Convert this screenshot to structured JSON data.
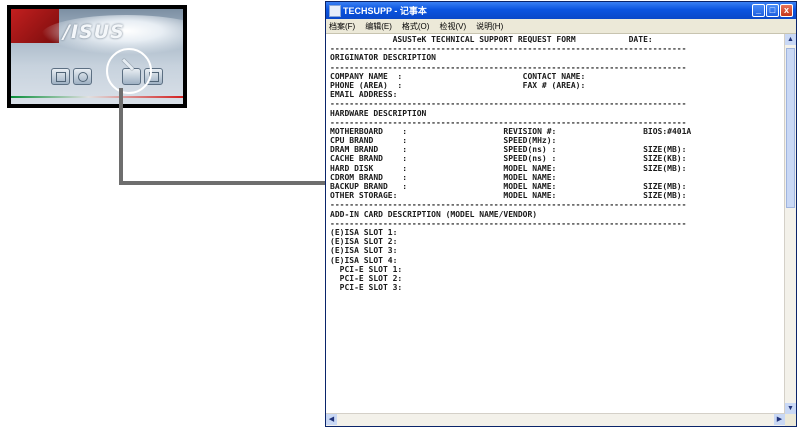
{
  "launcher": {
    "logo_text": "/ISUS",
    "buttons": [
      "info-icon",
      "globe-icon",
      "wrench-icon",
      "mail-icon"
    ],
    "highlighted": "wrench-icon"
  },
  "window": {
    "title": "TECHSUPP - 记事本",
    "menu": [
      "档案(F)",
      "编辑(E)",
      "格式(O)",
      "检视(V)",
      "说明(H)"
    ],
    "controls": {
      "minimize": "_",
      "maximize": "□",
      "close": "x"
    },
    "lines": [
      "             ASUSTeK TECHNICAL SUPPORT REQUEST FORM           DATE:",
      "--------------------------------------------------------------------------",
      "ORIGINATOR DESCRIPTION",
      "--------------------------------------------------------------------------",
      "COMPANY NAME  :                         CONTACT NAME:",
      "PHONE (AREA)  :                         FAX # (AREA):",
      "EMAIL ADDRESS:",
      "--------------------------------------------------------------------------",
      "HARDWARE DESCRIPTION",
      "--------------------------------------------------------------------------",
      "MOTHERBOARD    :                    REVISION #:                  BIOS:#401A",
      "CPU BRAND      :                    SPEED(MHz):",
      "DRAM BRAND     :                    SPEED(ns) :                  SIZE(MB):",
      "CACHE BRAND    :                    SPEED(ns) :                  SIZE(KB):",
      "HARD DISK      :                    MODEL NAME:                  SIZE(MB):",
      "CDROM BRAND    :                    MODEL NAME:",
      "BACKUP BRAND   :                    MODEL NAME:                  SIZE(MB):",
      "OTHER STORAGE:                      MODEL NAME:                  SIZE(MB):",
      "--------------------------------------------------------------------------",
      "ADD-IN CARD DESCRIPTION (MODEL NAME/VENDOR)",
      "--------------------------------------------------------------------------",
      "(E)ISA SLOT 1:",
      "(E)ISA SLOT 2:",
      "(E)ISA SLOT 3:",
      "(E)ISA SLOT 4:",
      "  PCI-E SLOT 1:",
      "  PCI-E SLOT 2:",
      "  PCI-E SLOT 3:",
      ""
    ]
  },
  "scrollbar": {
    "up": "▲",
    "down": "▼",
    "left": "◀",
    "right": "▶"
  }
}
